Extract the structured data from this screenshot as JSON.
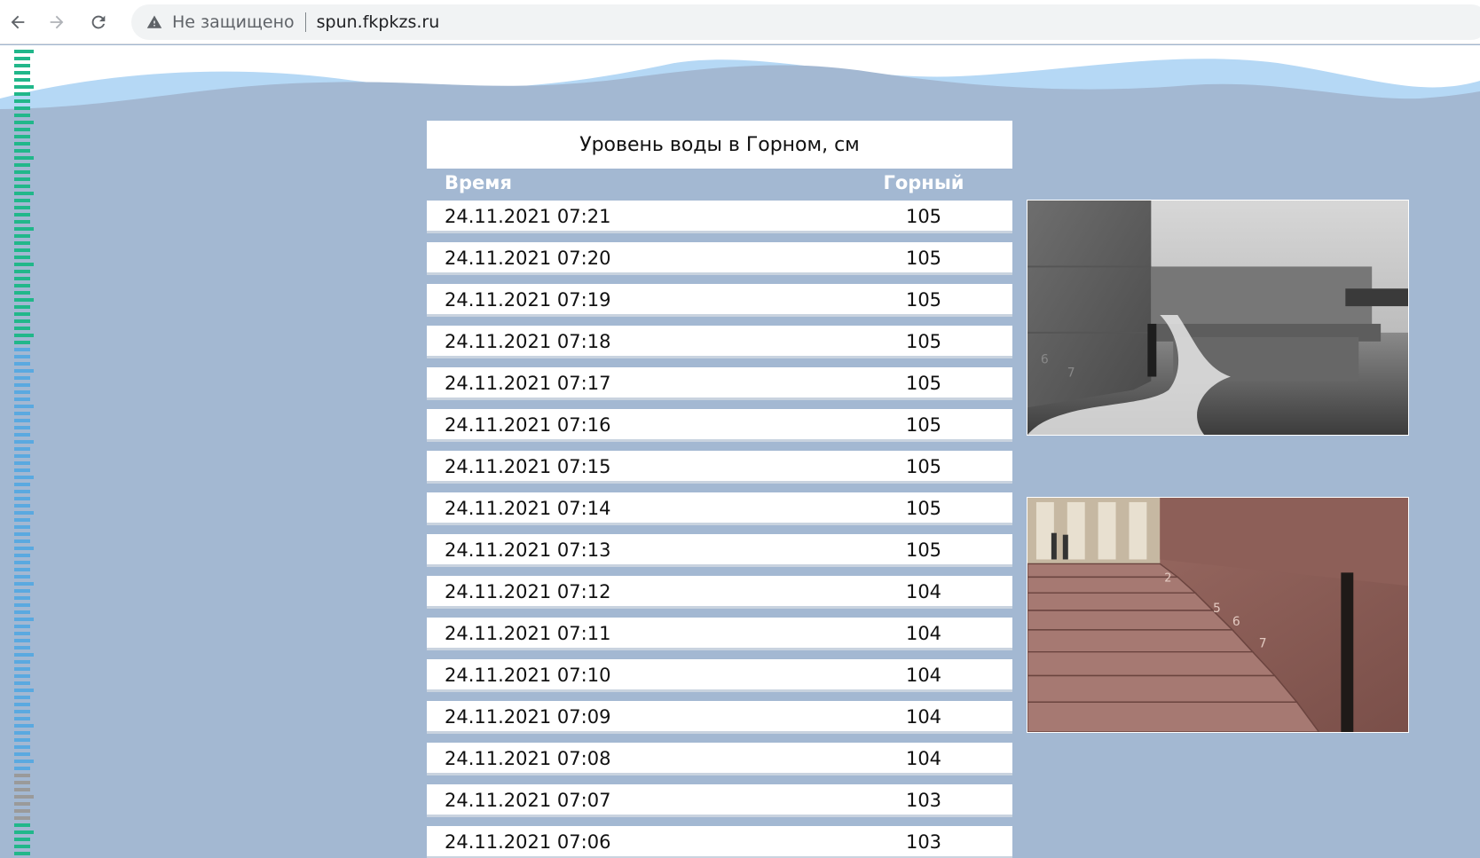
{
  "browser": {
    "security_label": "Не защищено",
    "url": "spun.fkpkzs.ru",
    "icons": {
      "back": "arrow-left-icon",
      "forward": "arrow-right-icon",
      "reload": "reload-icon",
      "warning": "warning-triangle-icon"
    }
  },
  "colors": {
    "page_background": "#a3b8d2",
    "wave_light": "#b5d8f5",
    "header_text": "#ffffff",
    "ruler_green": "#21b78a",
    "ruler_blue": "#5aa9e0",
    "ruler_grey": "#9a9a9a"
  },
  "table": {
    "title": "Уровень воды в Горном, см",
    "headers": {
      "time": "Время",
      "level": "Горный"
    },
    "rows": [
      {
        "time": "24.11.2021 07:21",
        "level": "105"
      },
      {
        "time": "24.11.2021 07:20",
        "level": "105"
      },
      {
        "time": "24.11.2021 07:19",
        "level": "105"
      },
      {
        "time": "24.11.2021 07:18",
        "level": "105"
      },
      {
        "time": "24.11.2021 07:17",
        "level": "105"
      },
      {
        "time": "24.11.2021 07:16",
        "level": "105"
      },
      {
        "time": "24.11.2021 07:15",
        "level": "105"
      },
      {
        "time": "24.11.2021 07:14",
        "level": "105"
      },
      {
        "time": "24.11.2021 07:13",
        "level": "105"
      },
      {
        "time": "24.11.2021 07:12",
        "level": "104"
      },
      {
        "time": "24.11.2021 07:11",
        "level": "104"
      },
      {
        "time": "24.11.2021 07:10",
        "level": "104"
      },
      {
        "time": "24.11.2021 07:09",
        "level": "104"
      },
      {
        "time": "24.11.2021 07:08",
        "level": "104"
      },
      {
        "time": "24.11.2021 07:07",
        "level": "103"
      },
      {
        "time": "24.11.2021 07:06",
        "level": "103"
      }
    ]
  },
  "photos": [
    {
      "icon": "flood-embankment-photo"
    },
    {
      "icon": "granite-steps-gauge-photo"
    }
  ]
}
